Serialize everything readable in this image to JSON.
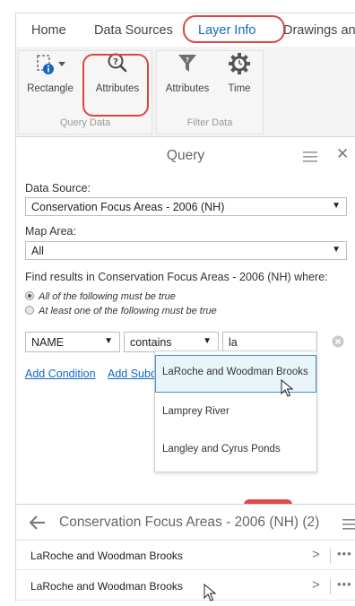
{
  "ribbon": {
    "tabs": [
      "Home",
      "Data Sources",
      "Layer Info",
      "Drawings an"
    ],
    "active_tab_index": 2,
    "query_data": {
      "group_label": "Query Data",
      "rectangle_label": "Rectangle",
      "attributes_label": "Attributes"
    },
    "filter_data": {
      "group_label": "Filter Data",
      "attributes_label": "Attributes",
      "time_label": "Time"
    }
  },
  "query_panel": {
    "title": "Query",
    "data_source_label": "Data Source:",
    "data_source_value": "Conservation Focus Areas - 2006 (NH)",
    "map_area_label": "Map Area:",
    "map_area_value": "All",
    "find_text": "Find results in Conservation Focus Areas - 2006 (NH) where:",
    "radio_all": "All of the following must be true",
    "radio_any": "At least one of the following must be true",
    "condition": {
      "field": "NAME",
      "operator": "contains",
      "value": "la"
    },
    "add_condition": "Add Condition",
    "add_subcondition": "Add Subc",
    "suggestions": [
      "LaRoche and Woodman Brooks",
      "Lamprey River",
      "Langley and Cyrus Ponds"
    ]
  },
  "results": {
    "title": "Conservation Focus Areas - 2006 (NH) (2)",
    "rows": [
      "LaRoche and Woodman Brooks",
      "LaRoche and Woodman Brooks"
    ]
  },
  "colors": {
    "accent": "#1565c0",
    "highlight_ring": "#dd4444",
    "filter_icon": "#6e6e6e"
  }
}
